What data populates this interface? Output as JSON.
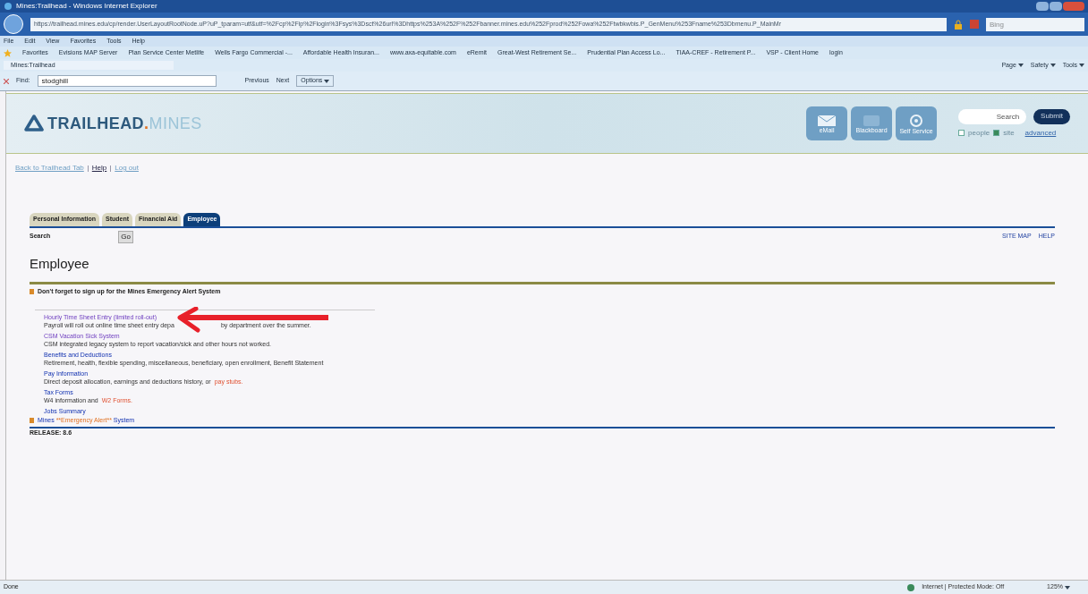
{
  "window": {
    "title": "Mines:Trailhead - Windows Internet Explorer"
  },
  "address_bar": {
    "url": "https://trailhead.mines.edu/cp/render.UserLayoutRootNode.uP?uP_tparam=utf&utf=%2Fcp%2Fip%2Flogin%3Fsys%3Dsct%26url%3Dhttps%253A%252F%252Fbanner.mines.edu%252Fprod%252Fowa%252Ftwbkwbis.P_GenMenu%253Fname%253Dbmenu.P_MainMr",
    "search_placeholder": "Bing"
  },
  "menu": [
    "File",
    "Edit",
    "View",
    "Favorites",
    "Tools",
    "Help"
  ],
  "favorites": [
    "Favorites",
    "Evisions MAP Server",
    "Plan Service Center Metlife",
    "Wells Fargo Commercial -...",
    "Affordable Health Insuran...",
    "www.axa-equitable.com",
    "eRemit",
    "Great-West Retirement Se...",
    "Prudential Plan Access Lo...",
    "TIAA-CREF - Retirement P...",
    "VSP - Client Home",
    "login"
  ],
  "browser_tab": "Mines:Trailhead",
  "command_bar": [
    "Page",
    "Safety",
    "Tools"
  ],
  "find_bar": {
    "label": "Find:",
    "value": "stodghill",
    "previous": "Previous",
    "next": "Next",
    "options": "Options"
  },
  "banner": {
    "logo_main": "TRAILHEAD",
    "logo_dot": ".",
    "logo_sub": "MINES",
    "apps": [
      {
        "label": "eMail",
        "kind": "mail"
      },
      {
        "label": "Blackboard",
        "kind": "bb"
      },
      {
        "label": "Self Service",
        "kind": "at"
      }
    ],
    "search_placeholder": "Search",
    "submit": "Submit",
    "scopes": [
      {
        "label": "people",
        "checked": false
      },
      {
        "label": "site",
        "checked": true
      }
    ],
    "advanced": "advanced"
  },
  "top_links": [
    "Back to Trailhead Tab",
    "Help",
    "Log out"
  ],
  "tabs": [
    {
      "label": "Personal Information",
      "selected": false
    },
    {
      "label": "Student",
      "selected": false
    },
    {
      "label": "Financial Aid",
      "selected": false
    },
    {
      "label": "Employee",
      "selected": true
    }
  ],
  "search": {
    "label": "Search",
    "go": "Go"
  },
  "right_links": [
    "SITE MAP",
    "HELP"
  ],
  "heading": "Employee",
  "notice": "Don't forget to sign up for the Mines Emergency Alert System",
  "menu_items": [
    {
      "link": "Hourly Time Sheet Entry (limited roll-out)",
      "visited": true,
      "desc": [
        {
          "text": "Payroll will roll out online time sheet entry depa",
          "kind": "text"
        },
        {
          "text": "by department over the summer.",
          "kind": "text"
        }
      ]
    },
    {
      "link": "CSM Vacation Sick System",
      "visited": true,
      "desc": [
        {
          "text": "CSM integrated legacy system to report vacation/sick and other hours not worked.",
          "kind": "text"
        }
      ]
    },
    {
      "link": "Benefits and Deductions",
      "visited": false,
      "desc": [
        {
          "text": "Retirement, health, flexible spending, miscellaneous, beneficiary, open enrollment, Benefit Statement",
          "kind": "text"
        }
      ]
    },
    {
      "link": "Pay Information",
      "visited": false,
      "desc": [
        {
          "text": "Direct deposit allocation, earnings and deductions history, or",
          "kind": "text"
        },
        {
          "text": "pay stubs.",
          "kind": "link"
        }
      ]
    },
    {
      "link": "Tax Forms",
      "visited": false,
      "desc": [
        {
          "text": "W4 information and",
          "kind": "text"
        },
        {
          "text": "W2 Forms.",
          "kind": "link"
        }
      ]
    },
    {
      "link": "Jobs Summary",
      "visited": false
    }
  ],
  "alert_link": {
    "parts": [
      "Mines",
      "**Emergency Alert**",
      "System"
    ]
  },
  "release": "RELEASE: 8.6",
  "status_bar": {
    "left": "Done",
    "zone": "Internet | Protected Mode: Off",
    "zoom": "125%"
  }
}
